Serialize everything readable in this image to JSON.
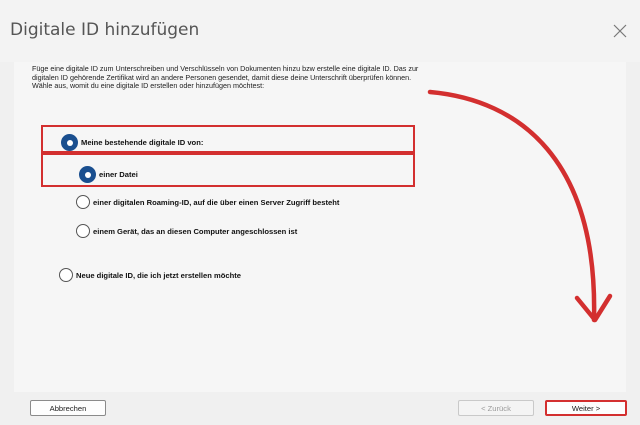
{
  "dialog": {
    "title": "Digitale ID hinzufügen",
    "close_icon": "close-icon"
  },
  "intro_text": "Füge eine digitale ID zum Unterschreiben und Verschlüsseln von Dokumenten hinzu bzw erstelle eine digitale ID. Das zur digitalen ID gehörende Zertifikat wird an andere Personen gesendet, damit diese deine Unterschrift überprüfen können. Wähle aus, womit du eine digitale ID erstellen oder hinzufügen möchtest:",
  "options": {
    "existing": {
      "label": "Meine bestehende digitale ID von:",
      "selected": true
    },
    "file": {
      "label": "einer Datei",
      "selected": true
    },
    "roaming": {
      "label": "einer digitalen Roaming-ID, auf die über einen Server Zugriff besteht",
      "selected": false
    },
    "device": {
      "label": "einem Gerät, das an diesen Computer angeschlossen ist",
      "selected": false
    },
    "new_id": {
      "label": "Neue digitale ID, die ich jetzt erstellen möchte",
      "selected": false
    }
  },
  "buttons": {
    "cancel": "Abbrechen",
    "back": "< Zurück",
    "next": "Weiter >"
  },
  "colors": {
    "accent": "#1a4f8f",
    "highlight": "#d32f2f"
  }
}
